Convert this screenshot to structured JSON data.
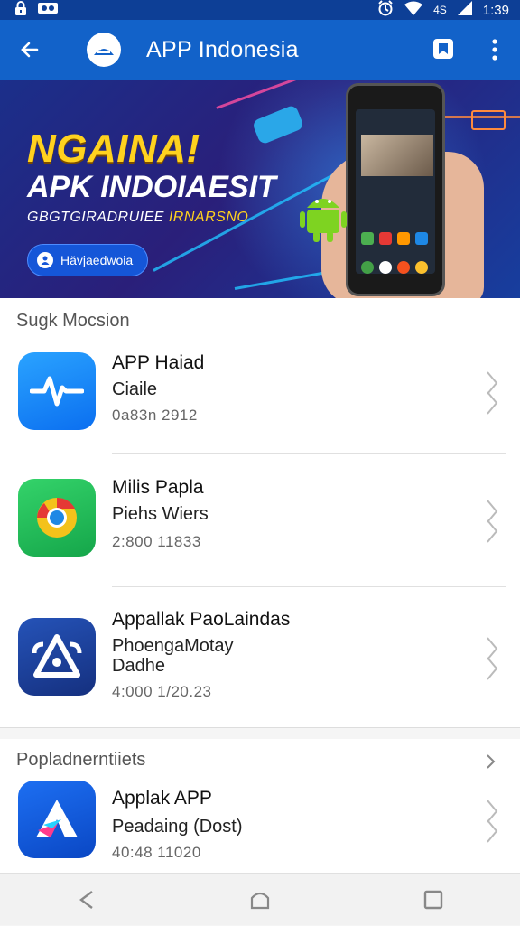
{
  "status_bar": {
    "left_icons": [
      "lock-icon",
      "voicemail-icon"
    ],
    "right_icons": [
      "alarm-icon",
      "wifi-icon",
      "signal-icon"
    ],
    "network_label": "4S",
    "time": "1:39"
  },
  "app_bar": {
    "title": "APP Indonesia",
    "back_icon": "arrow-left-icon",
    "logo_icon": "app-logo-icon",
    "bookmark_icon": "bookmark-icon",
    "menu_icon": "more-vert-icon"
  },
  "banner": {
    "headline": "NGAINA!",
    "title": "APK INDOIAESIT",
    "subtitle_a": "GBGTGIRADRUIEE",
    "subtitle_b": "IRNARSNO",
    "button_label": "Hävjaedwoia"
  },
  "section1": {
    "heading": "Sugk Mocsion",
    "items": [
      {
        "name": "APP Haiad",
        "subtitle": "Ciaile",
        "meta": "0a83n 2912"
      },
      {
        "name": "Milis Papla",
        "subtitle": "Piehs Wiers",
        "meta": "2:800 11833"
      },
      {
        "name": "Appallak PaoLaindas",
        "subtitle": "PhoengaMotay",
        "subtitle2": "Dadhe",
        "meta": "4:000 1/20.23"
      }
    ]
  },
  "section2": {
    "heading": "Popladnerntiiets",
    "items": [
      {
        "name": "Applak APP",
        "subtitle": "Peadaing (Dost)",
        "meta": "40:48 11020"
      }
    ]
  },
  "nav_bar": {
    "back_icon": "nav-back-icon",
    "home_icon": "nav-home-icon",
    "recents_icon": "nav-recents-icon"
  },
  "colors": {
    "primary": "#1262c9",
    "status": "#0d3f96",
    "accent_yellow": "#ffd21f"
  }
}
